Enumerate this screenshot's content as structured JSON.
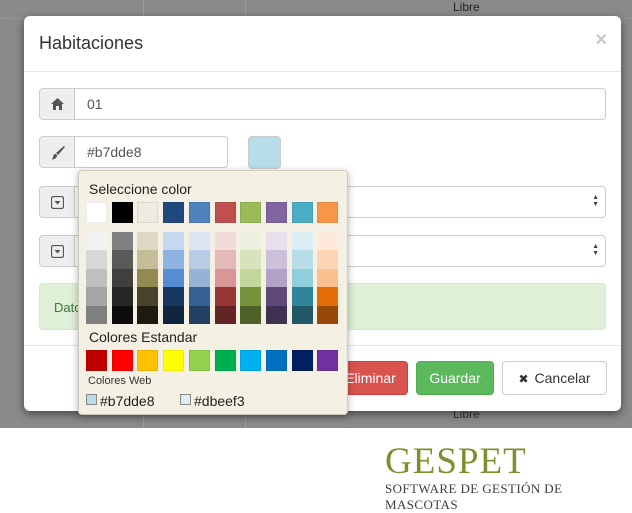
{
  "background": {
    "top_label": "Libre",
    "bottom_label": "Libre"
  },
  "modal": {
    "title": "Habitaciones",
    "close_symbol": "×",
    "room_number": "01",
    "color_value": "#b7dde8",
    "alert_text": "Dato",
    "buttons": {
      "delete": "Eliminar",
      "save": "Guardar",
      "cancel": "Cancelar",
      "cancel_symbol": "✖"
    },
    "icons": [
      "home-icon",
      "paint-brush-icon",
      "select-arrow-icon",
      "select-arrow-icon"
    ]
  },
  "color_picker": {
    "title": "Seleccione color",
    "theme_colors": [
      "#ffffff",
      "#000000",
      "#eeece1",
      "#1f497d",
      "#4f81bd",
      "#c0504d",
      "#9bbb59",
      "#8064a2",
      "#4bacc6",
      "#f79646"
    ],
    "shades": [
      [
        "#f2f2f2",
        "#d8d8d8",
        "#bfbfbf",
        "#a5a5a5",
        "#7f7f7f"
      ],
      [
        "#7f7f7f",
        "#595959",
        "#3f3f3f",
        "#262626",
        "#0c0c0c"
      ],
      [
        "#ddd9c3",
        "#c4bd97",
        "#938953",
        "#494429",
        "#1d1b10"
      ],
      [
        "#c6d9f0",
        "#8db3e2",
        "#548dd4",
        "#17365d",
        "#0f243e"
      ],
      [
        "#dbe5f1",
        "#b8cce4",
        "#95b3d7",
        "#366092",
        "#244061"
      ],
      [
        "#f2dcdb",
        "#e5b9b7",
        "#d99694",
        "#953734",
        "#632423"
      ],
      [
        "#ebf1dd",
        "#d7e3bc",
        "#c3d69b",
        "#76923c",
        "#4f6128"
      ],
      [
        "#e5e0ec",
        "#ccc1d9",
        "#b2a2c7",
        "#5f497a",
        "#3f3151"
      ],
      [
        "#dbeef3",
        "#b7dde8",
        "#92cddc",
        "#31859b",
        "#205867"
      ],
      [
        "#fdeada",
        "#fbd5b5",
        "#fac08f",
        "#e36c09",
        "#974806"
      ]
    ],
    "standard_title": "Colores Estandar",
    "standard_colors": [
      "#c00000",
      "#ff0000",
      "#ffc000",
      "#ffff00",
      "#92d050",
      "#00b050",
      "#00b0f0",
      "#0070c0",
      "#002060",
      "#7030a0"
    ],
    "web_title": "Colores Web",
    "web_colors": [
      {
        "label": "#b7dde8",
        "color": "#b7dde8"
      },
      {
        "label": "#dbeef3",
        "color": "#dbeef3"
      }
    ]
  },
  "logo": {
    "main": "GESPET",
    "subtitle": "SOFTWARE DE GESTIÓN DE MASCOTAS"
  }
}
